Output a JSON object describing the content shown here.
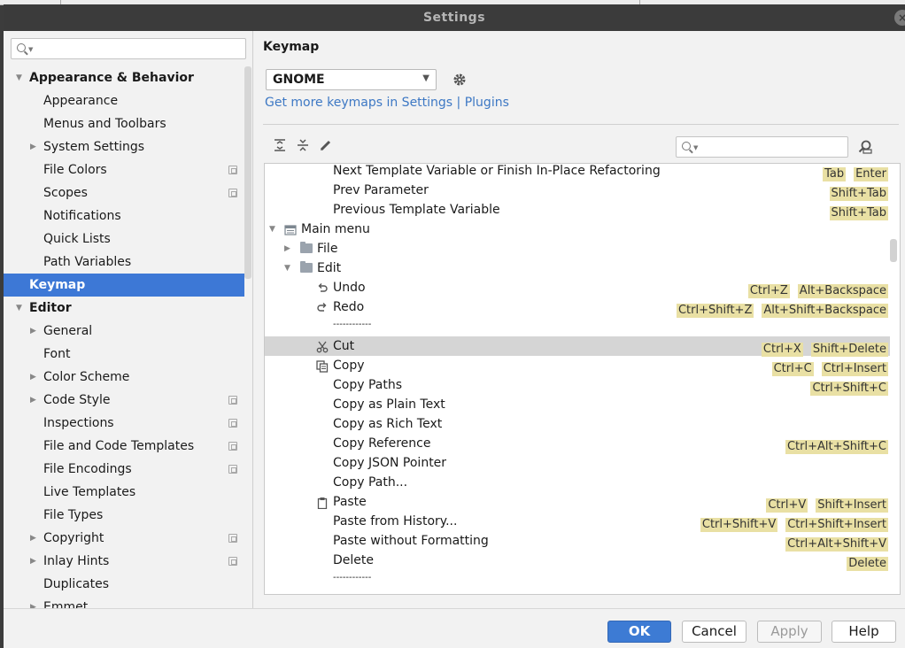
{
  "dialog": {
    "title": "Settings"
  },
  "sidebar": {
    "search_placeholder": "",
    "items": [
      {
        "label": "Appearance & Behavior",
        "level": 0,
        "arrow": "down",
        "bold": true
      },
      {
        "label": "Appearance",
        "level": 1
      },
      {
        "label": "Menus and Toolbars",
        "level": 1
      },
      {
        "label": "System Settings",
        "level": 1,
        "arrow": "right"
      },
      {
        "label": "File Colors",
        "level": 1,
        "project": true
      },
      {
        "label": "Scopes",
        "level": 1,
        "project": true
      },
      {
        "label": "Notifications",
        "level": 1
      },
      {
        "label": "Quick Lists",
        "level": 1
      },
      {
        "label": "Path Variables",
        "level": 1
      },
      {
        "label": "Keymap",
        "level": 0,
        "bold": true,
        "selected": true
      },
      {
        "label": "Editor",
        "level": 0,
        "arrow": "down",
        "bold": true
      },
      {
        "label": "General",
        "level": 1,
        "arrow": "right"
      },
      {
        "label": "Font",
        "level": 1
      },
      {
        "label": "Color Scheme",
        "level": 1,
        "arrow": "right"
      },
      {
        "label": "Code Style",
        "level": 1,
        "arrow": "right",
        "project": true
      },
      {
        "label": "Inspections",
        "level": 1,
        "project": true
      },
      {
        "label": "File and Code Templates",
        "level": 1,
        "project": true
      },
      {
        "label": "File Encodings",
        "level": 1,
        "project": true
      },
      {
        "label": "Live Templates",
        "level": 1
      },
      {
        "label": "File Types",
        "level": 1
      },
      {
        "label": "Copyright",
        "level": 1,
        "arrow": "right",
        "project": true
      },
      {
        "label": "Inlay Hints",
        "level": 1,
        "arrow": "right",
        "project": true
      },
      {
        "label": "Duplicates",
        "level": 1
      },
      {
        "label": "Emmet",
        "level": 1,
        "arrow": "right"
      }
    ]
  },
  "main": {
    "title": "Keymap",
    "scheme": "GNOME",
    "get_more": "Get more keymaps in Settings | Plugins",
    "search_placeholder": "",
    "actions": [
      {
        "label": "Next Template Variable or Finish In-Place Refactoring",
        "indent": 2,
        "keys": [
          "Tab",
          "Enter"
        ]
      },
      {
        "label": "Prev Parameter",
        "indent": 2,
        "keys": [
          "Shift+Tab"
        ]
      },
      {
        "label": "Previous Template Variable",
        "indent": 2,
        "keys": [
          "Shift+Tab"
        ]
      },
      {
        "label": "Main menu",
        "indent": 0,
        "arrow": "down",
        "icon": "menu-icon",
        "keys": []
      },
      {
        "label": "File",
        "indent": 1,
        "arrow": "right",
        "icon": "folder-icon",
        "keys": []
      },
      {
        "label": "Edit",
        "indent": 1,
        "arrow": "down",
        "icon": "folder-icon",
        "keys": []
      },
      {
        "label": "Undo",
        "indent": 2,
        "icon": "undo-icon",
        "keys": [
          "Ctrl+Z",
          "Alt+Backspace"
        ]
      },
      {
        "label": "Redo",
        "indent": 2,
        "icon": "redo-icon",
        "keys": [
          "Ctrl+Shift+Z",
          "Alt+Shift+Backspace"
        ]
      },
      {
        "label": "------------",
        "indent": 2,
        "keys": []
      },
      {
        "label": "Cut",
        "indent": 2,
        "icon": "scissors-icon",
        "selected": true,
        "keys": [
          "Ctrl+X",
          "Shift+Delete"
        ]
      },
      {
        "label": "Copy",
        "indent": 2,
        "icon": "copy-icon",
        "keys": [
          "Ctrl+C",
          "Ctrl+Insert"
        ]
      },
      {
        "label": "Copy Paths",
        "indent": 2,
        "keys": [
          "Ctrl+Shift+C"
        ]
      },
      {
        "label": "Copy as Plain Text",
        "indent": 2,
        "keys": []
      },
      {
        "label": "Copy as Rich Text",
        "indent": 2,
        "keys": []
      },
      {
        "label": "Copy Reference",
        "indent": 2,
        "keys": [
          "Ctrl+Alt+Shift+C"
        ]
      },
      {
        "label": "Copy JSON Pointer",
        "indent": 2,
        "keys": []
      },
      {
        "label": "Copy Path...",
        "indent": 2,
        "keys": []
      },
      {
        "label": "Paste",
        "indent": 2,
        "icon": "clipboard-icon",
        "keys": [
          "Ctrl+V",
          "Shift+Insert"
        ]
      },
      {
        "label": "Paste from History...",
        "indent": 2,
        "keys": [
          "Ctrl+Shift+V",
          "Ctrl+Shift+Insert"
        ]
      },
      {
        "label": "Paste without Formatting",
        "indent": 2,
        "keys": [
          "Ctrl+Alt+Shift+V"
        ]
      },
      {
        "label": "Delete",
        "indent": 2,
        "keys": [
          "Delete"
        ]
      },
      {
        "label": "------------",
        "indent": 2,
        "keys": []
      }
    ]
  },
  "footer": {
    "ok": "OK",
    "cancel": "Cancel",
    "apply": "Apply",
    "help": "Help"
  }
}
